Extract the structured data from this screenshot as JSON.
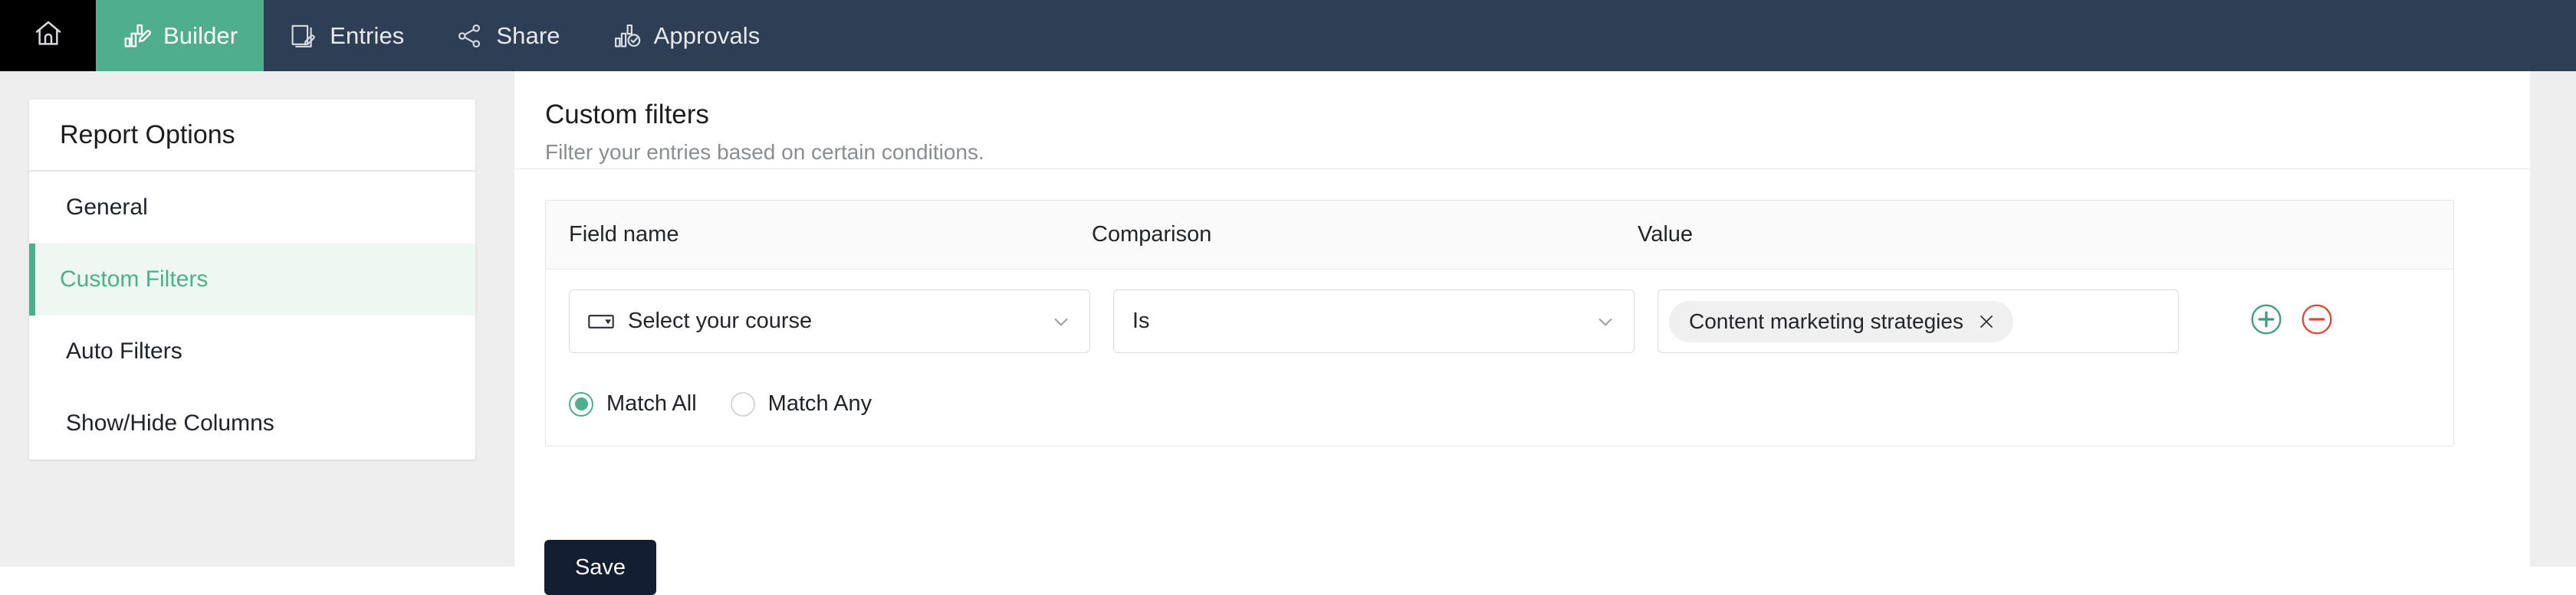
{
  "topnav": {
    "home_icon": "home-icon",
    "tabs": [
      {
        "label": "Builder",
        "icon": "chart-pencil-icon",
        "active": true
      },
      {
        "label": "Entries",
        "icon": "documents-pencil-icon",
        "active": false
      },
      {
        "label": "Share",
        "icon": "share-nodes-icon",
        "active": false
      },
      {
        "label": "Approvals",
        "icon": "chart-check-icon",
        "active": false
      }
    ],
    "bg_color": "#2e3e54",
    "active_color": "#4fae8e"
  },
  "sidebar": {
    "title": "Report Options",
    "items": [
      {
        "label": "General",
        "active": false
      },
      {
        "label": "Custom Filters",
        "active": true
      },
      {
        "label": "Auto Filters",
        "active": false
      },
      {
        "label": "Show/Hide Columns",
        "active": false
      }
    ],
    "active_color": "#4fae8e",
    "active_bg": "#edf8f3"
  },
  "main": {
    "title": "Custom filters",
    "subtitle": "Filter your entries based on certain conditions."
  },
  "filter_table": {
    "headers": {
      "field_name": "Field name",
      "comparison": "Comparison",
      "value": "Value"
    },
    "rows": [
      {
        "field_name": "Select your course",
        "field_icon": "dropdown-field-icon",
        "comparison": "Is",
        "value_chips": [
          "Content marketing strategies"
        ],
        "add_icon": "plus-circle-icon",
        "remove_icon": "minus-circle-icon"
      }
    ],
    "match_options": [
      {
        "label": "Match All",
        "selected": true
      },
      {
        "label": "Match Any",
        "selected": false
      }
    ],
    "add_color": "#3f9e7f",
    "remove_color": "#e0473e"
  },
  "actions": {
    "save_label": "Save"
  }
}
